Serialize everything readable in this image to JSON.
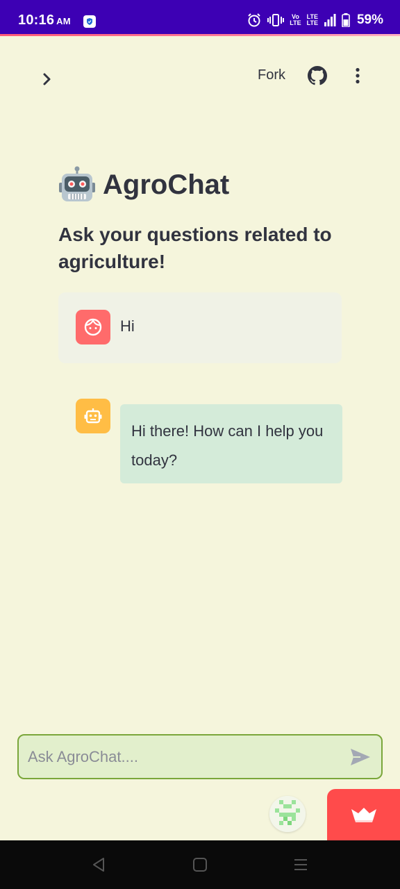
{
  "status_bar": {
    "time": "10:16",
    "ampm": "AM",
    "network_top": "Vo",
    "network_bottom": "LTE",
    "lte_top": "LTE",
    "lte_bottom": "LTE",
    "battery": "59%"
  },
  "header": {
    "fork_label": "Fork"
  },
  "main": {
    "title": "AgroChat",
    "subtitle": "Ask your questions related to agriculture!"
  },
  "chat": {
    "messages": [
      {
        "role": "user",
        "text": "Hi"
      },
      {
        "role": "assistant",
        "text": "Hi there! How can I help you today?"
      }
    ]
  },
  "input": {
    "placeholder": "Ask AgroChat...."
  },
  "colors": {
    "page_bg": "#f5f5dc",
    "status_bar": "#3d00b4",
    "user_avatar": "#ff6b6b",
    "bot_avatar": "#ffbd45",
    "bot_bubble": "#d4ebd9",
    "input_border": "#7aa63a",
    "streamlit_red": "#ff4b4b"
  },
  "icons": {
    "sidebar_toggle": "chevron-right-icon",
    "github": "github-icon",
    "menu": "more-vertical-icon",
    "send": "send-icon",
    "user_avatar": "face-icon",
    "bot_avatar": "robot-icon",
    "streamlit": "crown-icon"
  }
}
